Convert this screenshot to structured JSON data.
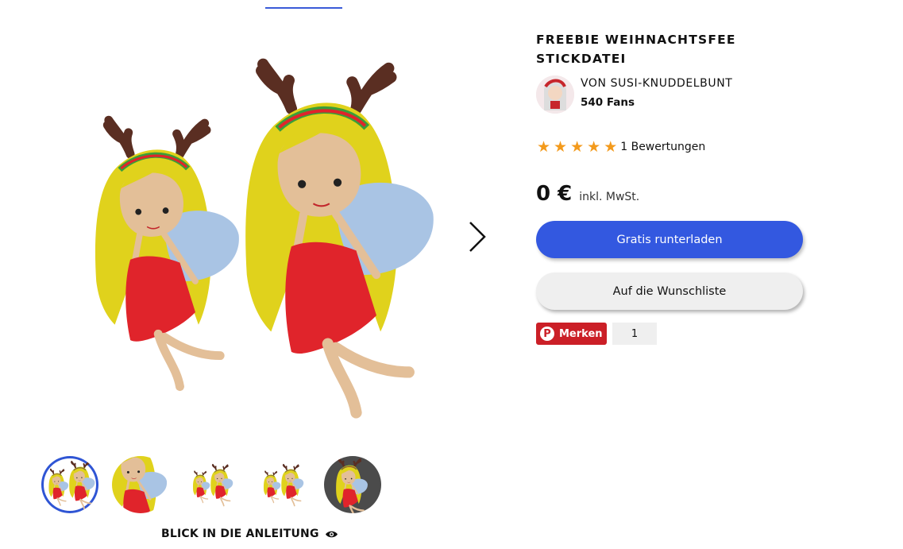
{
  "product": {
    "title": "FREEBIE WEIHNACHTSFEE STICKDATEI",
    "designer_prefix": "VON",
    "designer_name": "SUSI-KNUDDELBUNT",
    "designer_line": "VON SUSI-KNUDDELBUNT",
    "fans": "540 Fans",
    "rating_stars": 5,
    "rating_text": "1 Bewertungen",
    "price": "0 €",
    "price_note": "inkl. MwSt."
  },
  "actions": {
    "download_label": "Gratis runterladen",
    "wishlist_label": "Auf die Wunschliste",
    "pinterest_label": "Merken",
    "pinterest_count": "1"
  },
  "gallery": {
    "manual_link": "BLICK IN DIE ANLEITUNG",
    "active_thumb": 1,
    "thumb_count": 5
  },
  "colors": {
    "primary": "#3358e0",
    "pinterest": "#cb1f27",
    "star": "#f39a1c",
    "hair": "#e0d21c",
    "dress": "#e0242b",
    "wing": "#a9c4e4",
    "skin": "#e3bf98",
    "antler": "#5a2e22"
  },
  "icons": {
    "next": "chevron-right-icon",
    "eye": "eye-icon",
    "pinterest": "pinterest-icon",
    "star": "star-icon"
  }
}
